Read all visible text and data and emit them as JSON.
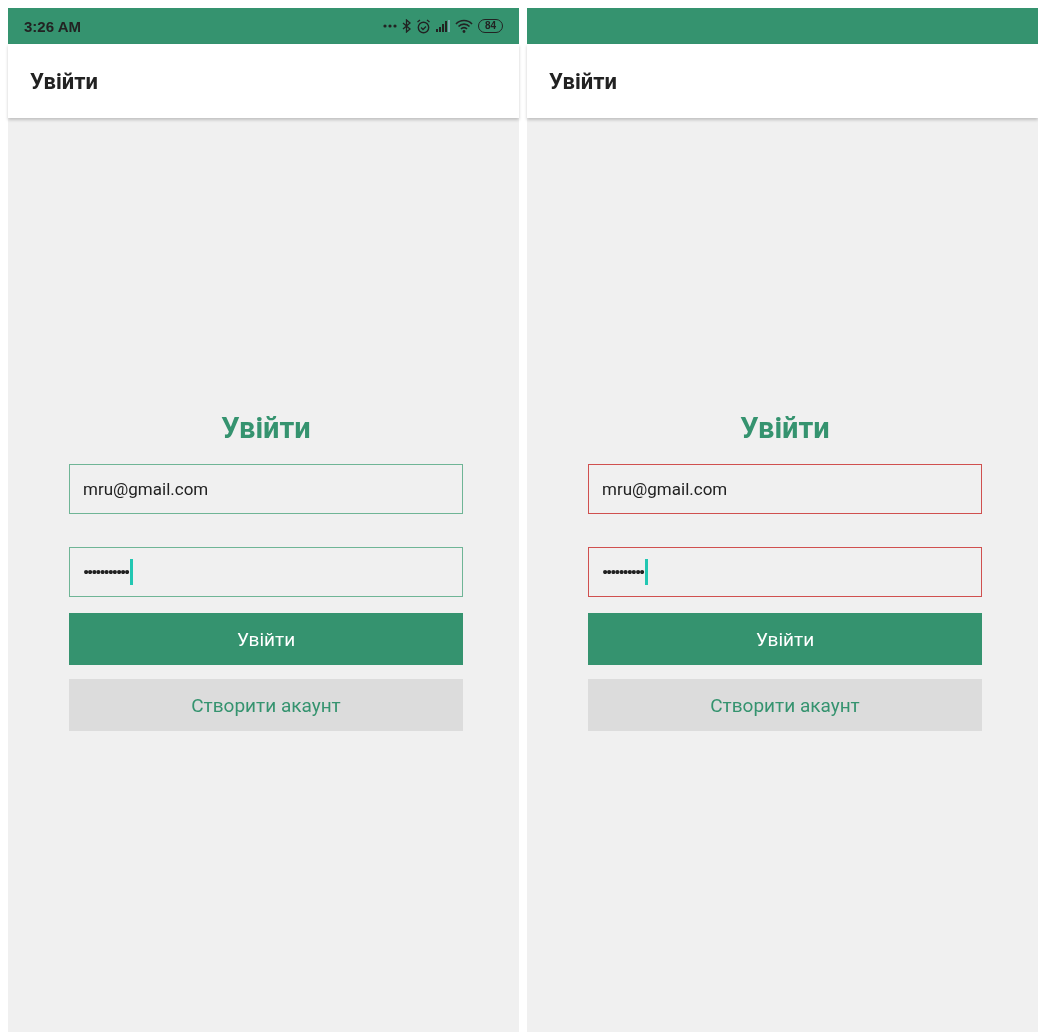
{
  "screens": [
    {
      "status_bar": {
        "time": "3:26 AM",
        "battery": "84"
      },
      "app_bar": {
        "title": "Увійти"
      },
      "form": {
        "title": "Увійти",
        "fields": [
          {
            "kind": "email",
            "value": "mru@gmail.com",
            "error": false,
            "focused": false
          },
          {
            "kind": "password",
            "value": "•••••••••••",
            "error": false,
            "focused": true
          }
        ],
        "buttons": [
          {
            "kind": "primary",
            "label": "Увійти"
          },
          {
            "kind": "secondary",
            "label": "Створити акаунт"
          }
        ]
      }
    },
    {
      "app_bar": {
        "title": "Увійти"
      },
      "form": {
        "title": "Увійти",
        "fields": [
          {
            "kind": "email",
            "value": "mru@gmail.com",
            "error": true,
            "focused": false
          },
          {
            "kind": "password",
            "value": "••••••••••",
            "error": true,
            "focused": true
          }
        ],
        "buttons": [
          {
            "kind": "primary",
            "label": "Увійти"
          },
          {
            "kind": "secondary",
            "label": "Створити акаунт"
          }
        ]
      }
    }
  ]
}
